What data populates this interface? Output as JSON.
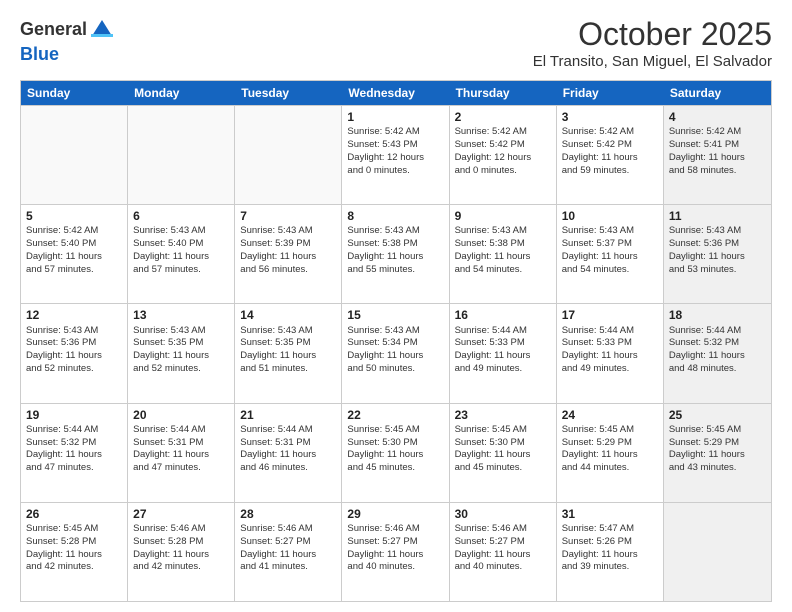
{
  "logo": {
    "general": "General",
    "blue": "Blue"
  },
  "header": {
    "month": "October 2025",
    "location": "El Transito, San Miguel, El Salvador"
  },
  "days_of_week": [
    "Sunday",
    "Monday",
    "Tuesday",
    "Wednesday",
    "Thursday",
    "Friday",
    "Saturday"
  ],
  "weeks": [
    [
      {
        "day": "",
        "info": "",
        "shaded": false
      },
      {
        "day": "",
        "info": "",
        "shaded": false
      },
      {
        "day": "",
        "info": "",
        "shaded": false
      },
      {
        "day": "1",
        "info": "Sunrise: 5:42 AM\nSunset: 5:43 PM\nDaylight: 12 hours\nand 0 minutes.",
        "shaded": false
      },
      {
        "day": "2",
        "info": "Sunrise: 5:42 AM\nSunset: 5:42 PM\nDaylight: 12 hours\nand 0 minutes.",
        "shaded": false
      },
      {
        "day": "3",
        "info": "Sunrise: 5:42 AM\nSunset: 5:42 PM\nDaylight: 11 hours\nand 59 minutes.",
        "shaded": false
      },
      {
        "day": "4",
        "info": "Sunrise: 5:42 AM\nSunset: 5:41 PM\nDaylight: 11 hours\nand 58 minutes.",
        "shaded": true
      }
    ],
    [
      {
        "day": "5",
        "info": "Sunrise: 5:42 AM\nSunset: 5:40 PM\nDaylight: 11 hours\nand 57 minutes.",
        "shaded": false
      },
      {
        "day": "6",
        "info": "Sunrise: 5:43 AM\nSunset: 5:40 PM\nDaylight: 11 hours\nand 57 minutes.",
        "shaded": false
      },
      {
        "day": "7",
        "info": "Sunrise: 5:43 AM\nSunset: 5:39 PM\nDaylight: 11 hours\nand 56 minutes.",
        "shaded": false
      },
      {
        "day": "8",
        "info": "Sunrise: 5:43 AM\nSunset: 5:38 PM\nDaylight: 11 hours\nand 55 minutes.",
        "shaded": false
      },
      {
        "day": "9",
        "info": "Sunrise: 5:43 AM\nSunset: 5:38 PM\nDaylight: 11 hours\nand 54 minutes.",
        "shaded": false
      },
      {
        "day": "10",
        "info": "Sunrise: 5:43 AM\nSunset: 5:37 PM\nDaylight: 11 hours\nand 54 minutes.",
        "shaded": false
      },
      {
        "day": "11",
        "info": "Sunrise: 5:43 AM\nSunset: 5:36 PM\nDaylight: 11 hours\nand 53 minutes.",
        "shaded": true
      }
    ],
    [
      {
        "day": "12",
        "info": "Sunrise: 5:43 AM\nSunset: 5:36 PM\nDaylight: 11 hours\nand 52 minutes.",
        "shaded": false
      },
      {
        "day": "13",
        "info": "Sunrise: 5:43 AM\nSunset: 5:35 PM\nDaylight: 11 hours\nand 52 minutes.",
        "shaded": false
      },
      {
        "day": "14",
        "info": "Sunrise: 5:43 AM\nSunset: 5:35 PM\nDaylight: 11 hours\nand 51 minutes.",
        "shaded": false
      },
      {
        "day": "15",
        "info": "Sunrise: 5:43 AM\nSunset: 5:34 PM\nDaylight: 11 hours\nand 50 minutes.",
        "shaded": false
      },
      {
        "day": "16",
        "info": "Sunrise: 5:44 AM\nSunset: 5:33 PM\nDaylight: 11 hours\nand 49 minutes.",
        "shaded": false
      },
      {
        "day": "17",
        "info": "Sunrise: 5:44 AM\nSunset: 5:33 PM\nDaylight: 11 hours\nand 49 minutes.",
        "shaded": false
      },
      {
        "day": "18",
        "info": "Sunrise: 5:44 AM\nSunset: 5:32 PM\nDaylight: 11 hours\nand 48 minutes.",
        "shaded": true
      }
    ],
    [
      {
        "day": "19",
        "info": "Sunrise: 5:44 AM\nSunset: 5:32 PM\nDaylight: 11 hours\nand 47 minutes.",
        "shaded": false
      },
      {
        "day": "20",
        "info": "Sunrise: 5:44 AM\nSunset: 5:31 PM\nDaylight: 11 hours\nand 47 minutes.",
        "shaded": false
      },
      {
        "day": "21",
        "info": "Sunrise: 5:44 AM\nSunset: 5:31 PM\nDaylight: 11 hours\nand 46 minutes.",
        "shaded": false
      },
      {
        "day": "22",
        "info": "Sunrise: 5:45 AM\nSunset: 5:30 PM\nDaylight: 11 hours\nand 45 minutes.",
        "shaded": false
      },
      {
        "day": "23",
        "info": "Sunrise: 5:45 AM\nSunset: 5:30 PM\nDaylight: 11 hours\nand 45 minutes.",
        "shaded": false
      },
      {
        "day": "24",
        "info": "Sunrise: 5:45 AM\nSunset: 5:29 PM\nDaylight: 11 hours\nand 44 minutes.",
        "shaded": false
      },
      {
        "day": "25",
        "info": "Sunrise: 5:45 AM\nSunset: 5:29 PM\nDaylight: 11 hours\nand 43 minutes.",
        "shaded": true
      }
    ],
    [
      {
        "day": "26",
        "info": "Sunrise: 5:45 AM\nSunset: 5:28 PM\nDaylight: 11 hours\nand 42 minutes.",
        "shaded": false
      },
      {
        "day": "27",
        "info": "Sunrise: 5:46 AM\nSunset: 5:28 PM\nDaylight: 11 hours\nand 42 minutes.",
        "shaded": false
      },
      {
        "day": "28",
        "info": "Sunrise: 5:46 AM\nSunset: 5:27 PM\nDaylight: 11 hours\nand 41 minutes.",
        "shaded": false
      },
      {
        "day": "29",
        "info": "Sunrise: 5:46 AM\nSunset: 5:27 PM\nDaylight: 11 hours\nand 40 minutes.",
        "shaded": false
      },
      {
        "day": "30",
        "info": "Sunrise: 5:46 AM\nSunset: 5:27 PM\nDaylight: 11 hours\nand 40 minutes.",
        "shaded": false
      },
      {
        "day": "31",
        "info": "Sunrise: 5:47 AM\nSunset: 5:26 PM\nDaylight: 11 hours\nand 39 minutes.",
        "shaded": false
      },
      {
        "day": "",
        "info": "",
        "shaded": true
      }
    ]
  ]
}
